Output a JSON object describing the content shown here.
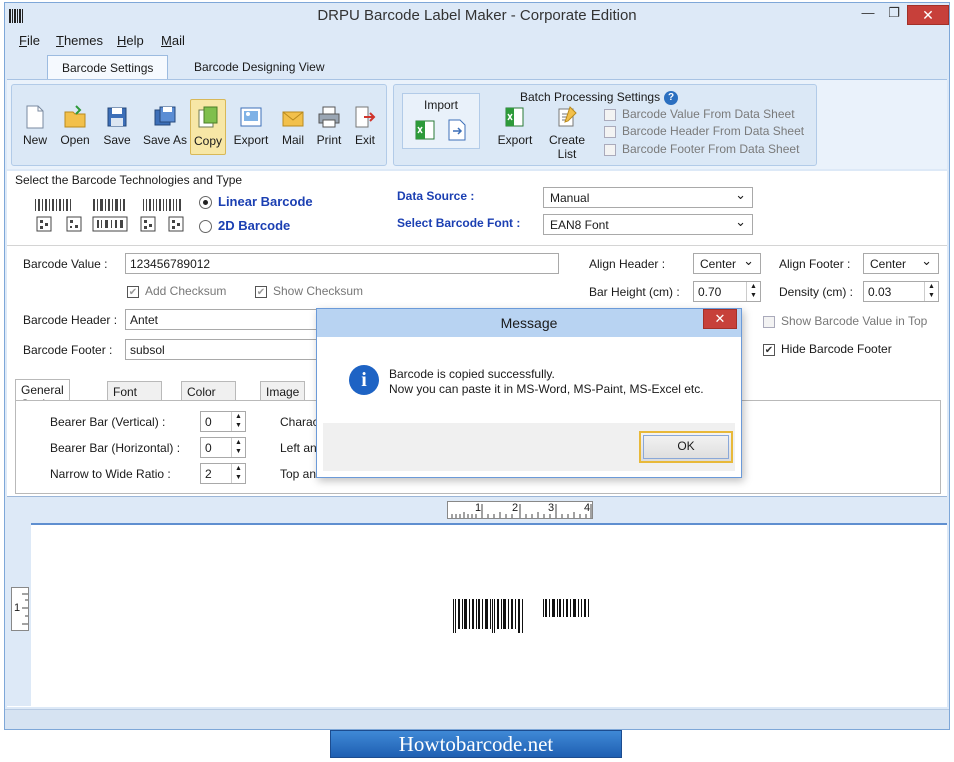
{
  "window": {
    "title": "DRPU Barcode Label Maker - Corporate Edition",
    "min_glyph": "—",
    "max_glyph": "❐",
    "close_glyph": "✕"
  },
  "menu": [
    {
      "label": "File",
      "key": "F",
      "rest": "ile"
    },
    {
      "label": "Themes",
      "key": "T",
      "rest": "hemes"
    },
    {
      "label": "Help",
      "key": "H",
      "rest": "elp"
    },
    {
      "label": "Mail",
      "key": "M",
      "rest": "ail"
    }
  ],
  "ribbon_tabs": [
    "Barcode Settings",
    "Barcode Designing View"
  ],
  "toolbar": {
    "new": "New",
    "open": "Open",
    "save": "Save",
    "save_as": "Save As",
    "copy": "Copy",
    "export": "Export",
    "mail": "Mail",
    "print": "Print",
    "exit": "Exit"
  },
  "batch": {
    "title": "Batch Processing Settings",
    "import_label": "Import",
    "export_label": "Export",
    "create_list_label": "Create List",
    "options": [
      "Barcode Value From Data Sheet",
      "Barcode Header From Data Sheet",
      "Barcode Footer From Data Sheet"
    ]
  },
  "tech": {
    "title": "Select the Barcode Technologies and Type",
    "linear": "Linear Barcode",
    "twod": "2D Barcode",
    "data_source_label": "Data Source :",
    "data_source_value": "Manual",
    "font_label": "Select Barcode Font :",
    "font_value": "EAN8 Font"
  },
  "form": {
    "value_label": "Barcode Value :",
    "value": "123456789012",
    "add_checksum": "Add Checksum",
    "show_checksum": "Show Checksum",
    "header_label": "Barcode Header :",
    "header_value": "Antet",
    "footer_label": "Barcode Footer :",
    "footer_value": "subsol",
    "align_header_label": "Align Header  :",
    "align_header_value": "Center",
    "align_footer_label": "Align Footer :",
    "align_footer_value": "Center",
    "bar_height_label": "Bar Height (cm) :",
    "bar_height_value": "0.70",
    "density_label": "Density (cm) :",
    "density_value": "0.03",
    "show_value_top": "Show Barcode Value in Top",
    "hide_footer": "Hide Barcode Footer"
  },
  "subtabs": [
    "General Settings",
    "Font Settings",
    "Color Settings",
    "Image Setti"
  ],
  "general": {
    "bearer_v_label": "Bearer Bar (Vertical) :",
    "bearer_v_value": "0",
    "bearer_h_label": "Bearer Bar (Horizontal) :",
    "bearer_h_value": "0",
    "ratio_label": "Narrow to Wide Ratio :",
    "ratio_value": "2",
    "char_label": "Charac",
    "left_label": "Left an",
    "top_label": "Top an"
  },
  "ruler": {
    "top": [
      "1",
      "2",
      "3",
      "4"
    ],
    "left": "1"
  },
  "dialog": {
    "title": "Message",
    "line1": "Barcode is copied successfully.",
    "line2": "Now you can paste it in MS-Word, MS-Paint, MS-Excel etc.",
    "ok": "OK",
    "close_glyph": "✕"
  },
  "watermark": "Howtobarcode.net",
  "colors": {
    "accent": "#1b3fb2",
    "window_bg": "#dde9f7",
    "close_red": "#c7403a",
    "ok_border": "#e8b93a"
  }
}
